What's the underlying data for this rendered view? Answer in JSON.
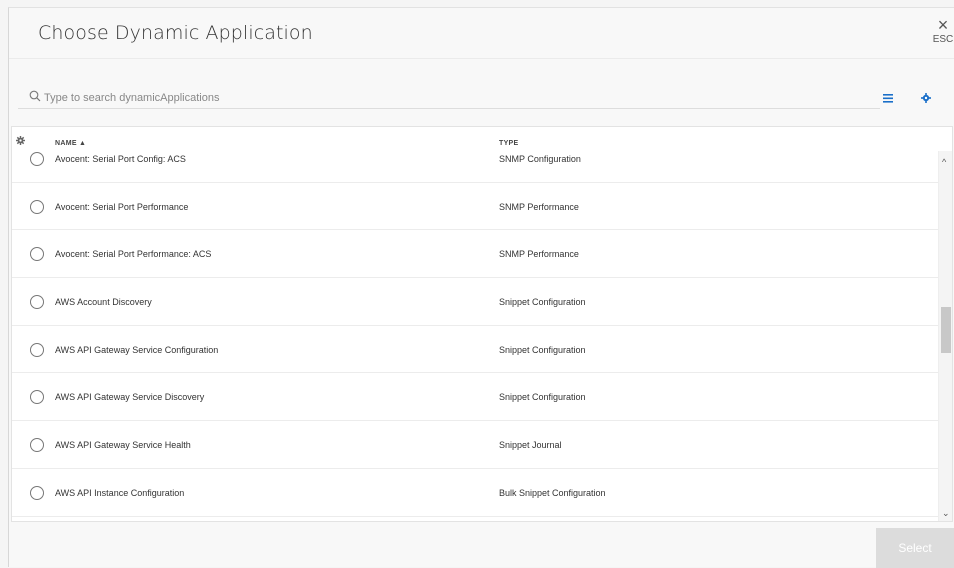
{
  "modal": {
    "title": "Choose Dynamic Application",
    "close_label": "ESC"
  },
  "search": {
    "placeholder": "Type to search dynamicApplications"
  },
  "table": {
    "columns": {
      "name": "NAME ▲",
      "type": "TYPE"
    },
    "rows": [
      {
        "name": "Avocent: Serial Port Config: ACS",
        "type": "SNMP Configuration"
      },
      {
        "name": "Avocent: Serial Port Performance",
        "type": "SNMP Performance"
      },
      {
        "name": "Avocent: Serial Port Performance: ACS",
        "type": "SNMP Performance"
      },
      {
        "name": "AWS Account Discovery",
        "type": "Snippet Configuration"
      },
      {
        "name": "AWS API Gateway Service Configuration",
        "type": "Snippet Configuration"
      },
      {
        "name": "AWS API Gateway Service Discovery",
        "type": "Snippet Configuration"
      },
      {
        "name": "AWS API Gateway Service Health",
        "type": "Snippet Journal"
      },
      {
        "name": "AWS API Instance Configuration",
        "type": "Bulk Snippet Configuration"
      }
    ]
  },
  "footer": {
    "select_label": "Select"
  },
  "colors": {
    "accent": "#1a6fc9",
    "disabled_button": "#dcdcdc"
  }
}
